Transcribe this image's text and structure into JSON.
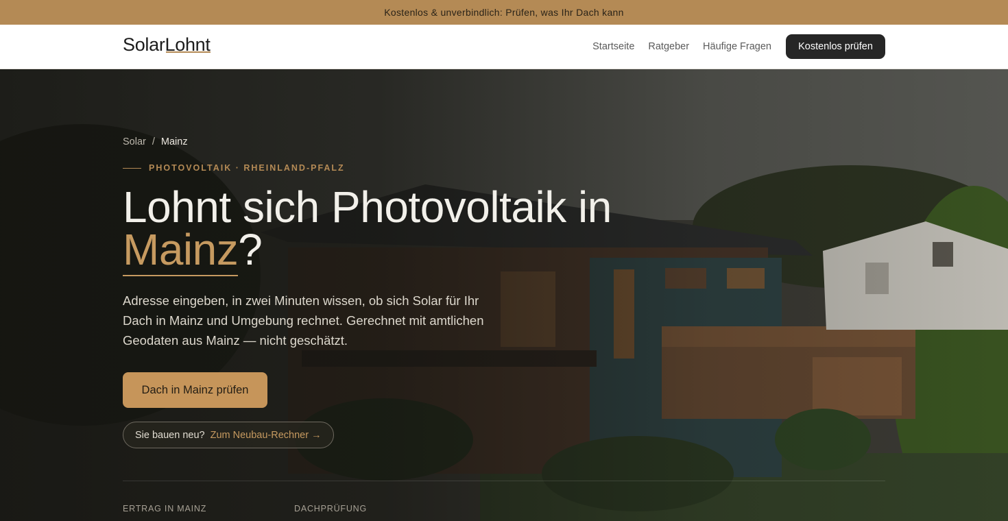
{
  "announcement": "Kostenlos & unverbindlich: Prüfen, was Ihr Dach kann",
  "nav": {
    "logo_a": "Solar",
    "logo_b": "Lohnt",
    "links": [
      "Startseite",
      "Ratgeber",
      "Häufige Fragen"
    ],
    "cta": "Kostenlos prüfen"
  },
  "hero": {
    "breadcrumb": {
      "root": "Solar",
      "separator": "/",
      "current": "Mainz"
    },
    "eyebrow": "PHOTOVOLTAIK · RHEINLAND-PFALZ",
    "headline_prefix": "Lohnt sich Photovoltaik in",
    "headline_city": "Mainz",
    "headline_suffix": "?",
    "lead": "Adresse eingeben, in zwei Minuten wissen, ob sich Solar für Ihr Dach in Mainz und Umgebung rechnet. Gerechnet mit amtlichen Geodaten aus Mainz — nicht geschätzt.",
    "primary_cta": "Dach in Mainz prüfen",
    "secondary_question": "Sie bauen neu?",
    "secondary_link": "Zum Neubau-Rechner →"
  },
  "stats": {
    "labels": [
      "ERTRAG IN MAINZ",
      "DACHPRÜFUNG"
    ]
  },
  "colors": {
    "accent": "#b48a55",
    "announcement_bg": "#b48a55",
    "nav_cta_bg": "#262626",
    "hero_cta_bg": "#c6955a"
  }
}
